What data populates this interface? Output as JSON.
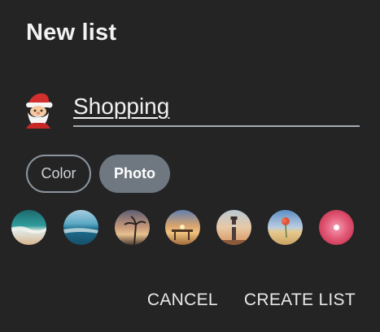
{
  "dialog": {
    "title": "New list"
  },
  "list_name": {
    "value": "Shopping",
    "emoji": "santa-claus-icon"
  },
  "background_type": {
    "options": [
      {
        "label": "Color",
        "selected": false
      },
      {
        "label": "Photo",
        "selected": true
      }
    ]
  },
  "photos": [
    {
      "name": "beach-waves-photo"
    },
    {
      "name": "ocean-shore-photo"
    },
    {
      "name": "palm-sunset-photo"
    },
    {
      "name": "pier-sunset-photo"
    },
    {
      "name": "lighthouse-photo"
    },
    {
      "name": "poppy-field-photo"
    },
    {
      "name": "pink-flower-photo"
    }
  ],
  "actions": {
    "cancel_label": "CANCEL",
    "create_label": "CREATE LIST"
  },
  "colors": {
    "background": "#242424",
    "chip_selected": "#6f7881",
    "chip_outline": "#8c959e",
    "underline": "#a4abb3"
  }
}
